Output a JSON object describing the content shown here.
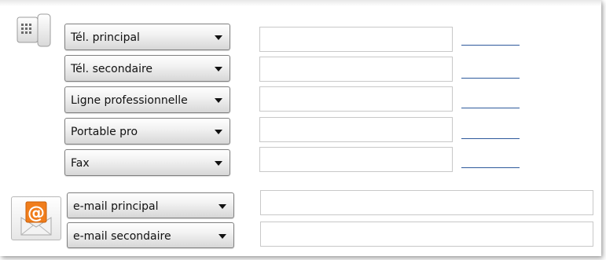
{
  "phone": {
    "icon": "phone-icon",
    "rows": [
      {
        "type_label": "Tél. principal",
        "value": "",
        "extension": ""
      },
      {
        "type_label": "Tél. secondaire",
        "value": "",
        "extension": ""
      },
      {
        "type_label": "Ligne professionnelle",
        "value": "",
        "extension": ""
      },
      {
        "type_label": "Portable pro",
        "value": "",
        "extension": ""
      },
      {
        "type_label": "Fax",
        "value": "",
        "extension": ""
      }
    ]
  },
  "email": {
    "icon": "email-icon",
    "rows": [
      {
        "type_label": "e-mail principal",
        "value": ""
      },
      {
        "type_label": "e-mail secondaire",
        "value": ""
      }
    ]
  },
  "colors": {
    "extension_line": "#2e5a9c",
    "email_icon_accent": "#f07d1b"
  }
}
